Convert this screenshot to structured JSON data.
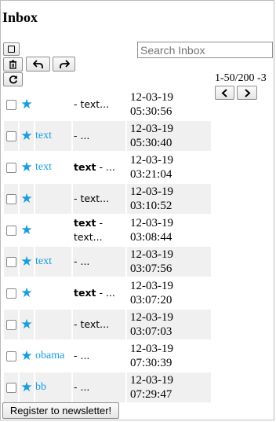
{
  "page": {
    "title": "Inbox"
  },
  "toolbar": {
    "select_icon": "checkbox-square-icon",
    "delete_icon": "trash-icon",
    "reply_icon": "reply-arrow-icon",
    "forward_icon": "forward-arrow-icon",
    "refresh_icon": "refresh-icon"
  },
  "search": {
    "placeholder": "Search Inbox",
    "value": ""
  },
  "pager": {
    "range": "1-50/200 -3",
    "prev_icon": "chevron-left-icon",
    "next_icon": "chevron-right-icon"
  },
  "colors": {
    "accent": "#1a9ce0",
    "row_alt": "#f0f0f0"
  },
  "messages": [
    {
      "sender": "",
      "subject": "",
      "preview": "- text...",
      "date": "12-03-19",
      "time": "05:30:56",
      "starred": true
    },
    {
      "sender": "text",
      "subject": "",
      "preview": "- ...",
      "date": "12-03-19",
      "time": "05:30:40",
      "starred": true
    },
    {
      "sender": "text",
      "subject": "text",
      "preview": " - ...",
      "date": "12-03-19",
      "time": "03:21:04",
      "starred": true
    },
    {
      "sender": "",
      "subject": "",
      "preview": "- text...",
      "date": "12-03-19",
      "time": "03:10:52",
      "starred": true
    },
    {
      "sender": "",
      "subject": "text",
      "preview": " - text...",
      "date": "12-03-19",
      "time": "03:08:44",
      "starred": true
    },
    {
      "sender": "text",
      "subject": "",
      "preview": "- ...",
      "date": "12-03-19",
      "time": "03:07:56",
      "starred": true
    },
    {
      "sender": "",
      "subject": "text",
      "preview": " - ...",
      "date": "12-03-19",
      "time": "03:07:20",
      "starred": true
    },
    {
      "sender": "",
      "subject": "",
      "preview": "- text...",
      "date": "12-03-19",
      "time": "03:07:03",
      "starred": true
    },
    {
      "sender": "obama",
      "subject": "",
      "preview": "- ...",
      "date": "12-03-19",
      "time": "07:30:39",
      "starred": true
    },
    {
      "sender": "bb",
      "subject": "",
      "preview": "- ...",
      "date": "12-03-19",
      "time": "07:29:47",
      "starred": true
    }
  ],
  "footer": {
    "newsletter_label": "Register to newsletter!"
  }
}
